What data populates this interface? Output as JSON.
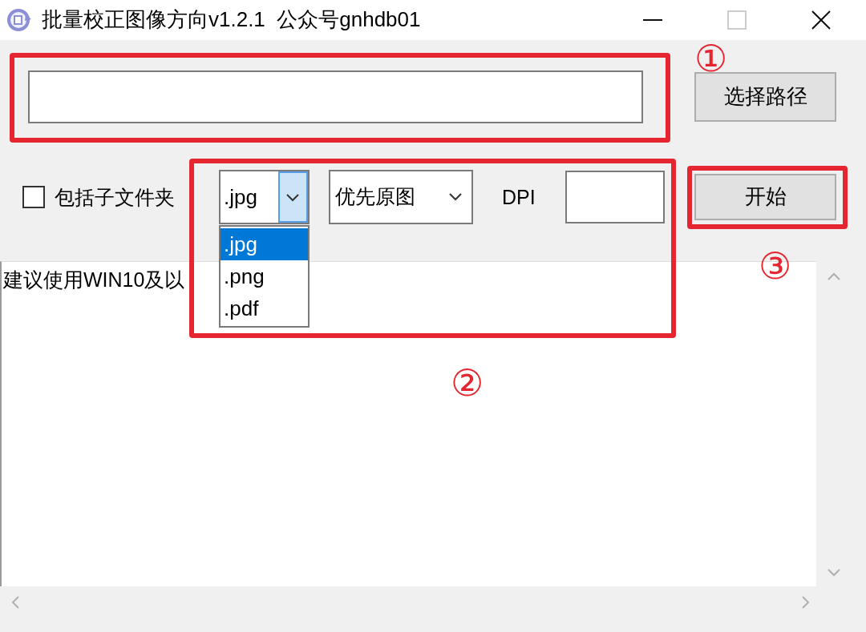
{
  "window": {
    "title": "批量校正图像方向v1.2.1  公众号gnhdb01",
    "controls": [
      {
        "kind": "minimize",
        "disabled": false
      },
      {
        "kind": "maximize",
        "disabled": true
      },
      {
        "kind": "close",
        "disabled": false
      }
    ]
  },
  "path_row": {
    "browse_button": "选择路径"
  },
  "options_row": {
    "include_subfolders": {
      "label": "包括子文件夹",
      "checked": false
    },
    "format_combo": {
      "value": ".jpg",
      "expanded": true,
      "options": [
        {
          "label": ".jpg",
          "selected": true
        },
        {
          "label": ".png",
          "selected": false
        },
        {
          "label": ".pdf",
          "selected": false
        }
      ]
    },
    "mode_combo": {
      "value": "优先原图"
    },
    "dpi_label": "DPI",
    "start_button": "开始"
  },
  "log": {
    "text": "建议使用WIN10及以"
  },
  "annotations": [
    {
      "label": "①"
    },
    {
      "label": "②"
    },
    {
      "label": "③"
    }
  ]
}
